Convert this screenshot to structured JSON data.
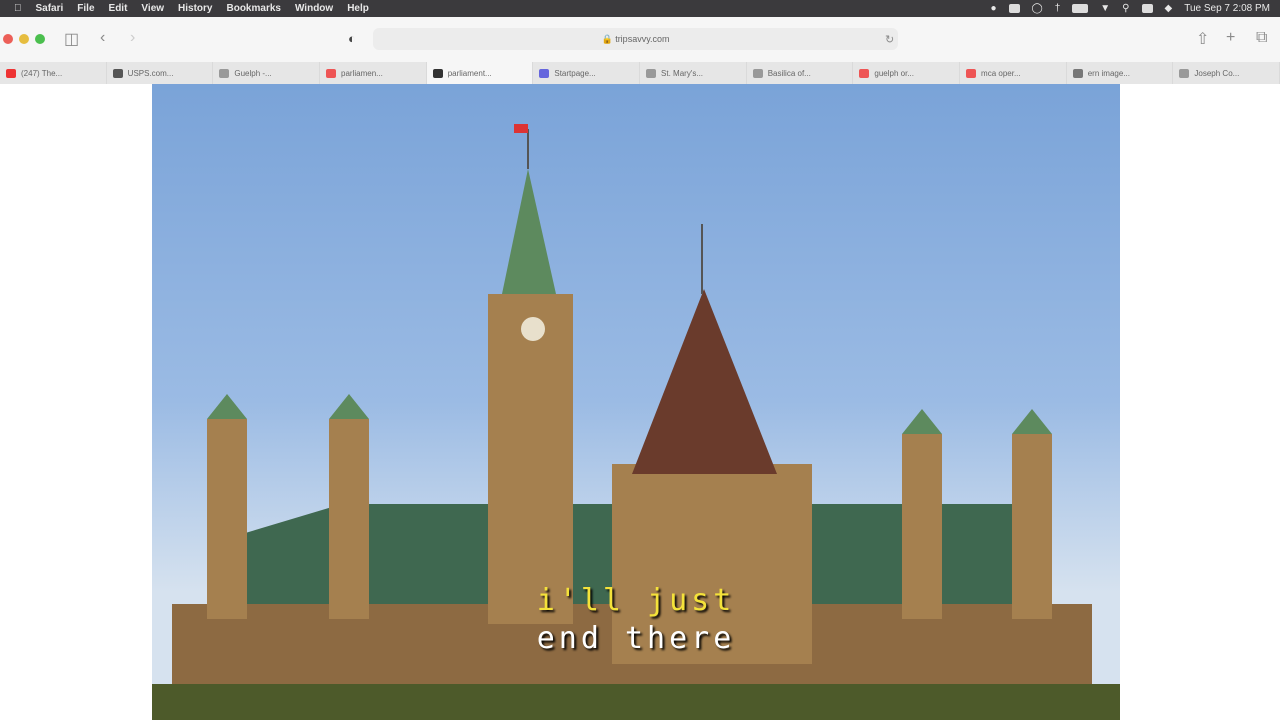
{
  "menubar": {
    "app": "Safari",
    "items": [
      "File",
      "Edit",
      "View",
      "History",
      "Bookmarks",
      "Window",
      "Help"
    ],
    "clock": "Tue Sep 7  2:08 PM"
  },
  "toolbar": {
    "url": "tripsavvy.com"
  },
  "tabs": [
    {
      "label": "(247) The...",
      "color": "#e33"
    },
    {
      "label": "USPS.com...",
      "color": "#555"
    },
    {
      "label": "Guelph -...",
      "color": "#999"
    },
    {
      "label": "parliamen...",
      "color": "#e55"
    },
    {
      "label": "parliament...",
      "color": "#333",
      "active": true
    },
    {
      "label": "Startpage...",
      "color": "#66d"
    },
    {
      "label": "St. Mary's...",
      "color": "#999"
    },
    {
      "label": "Basilica of...",
      "color": "#999"
    },
    {
      "label": "guelph or...",
      "color": "#e55"
    },
    {
      "label": "mca oper...",
      "color": "#e55"
    },
    {
      "label": "ern image...",
      "color": "#777"
    },
    {
      "label": "Joseph Co...",
      "color": "#999"
    }
  ],
  "caption": {
    "line1": "i'll just",
    "line2": "end there"
  }
}
